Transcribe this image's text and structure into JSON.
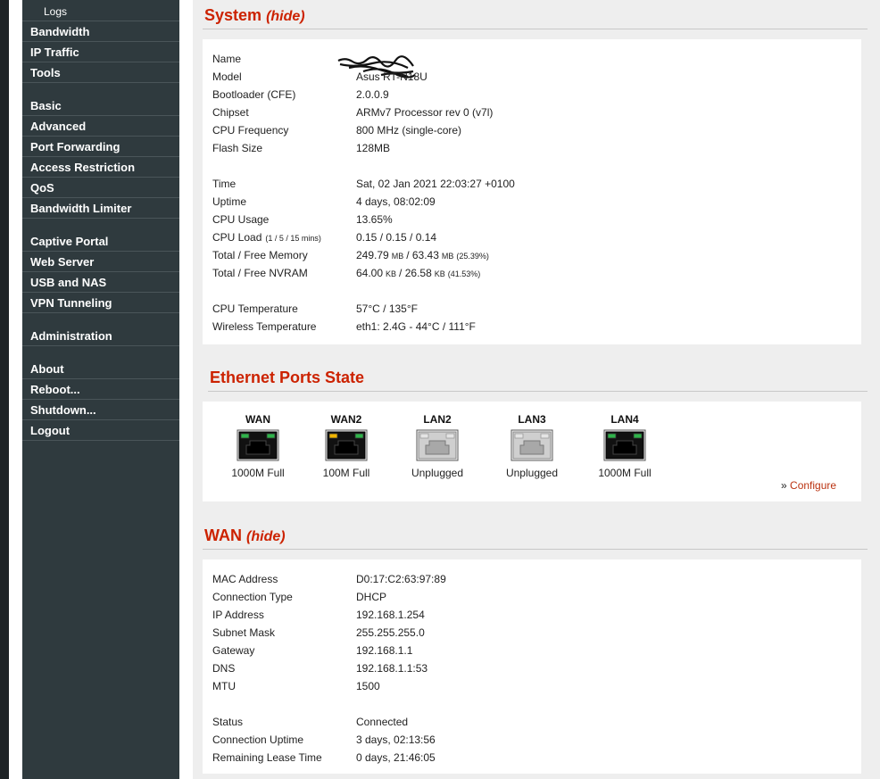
{
  "nav": {
    "items": [
      {
        "label": "Logs",
        "sub": true
      },
      {
        "label": "Bandwidth"
      },
      {
        "label": "IP Traffic"
      },
      {
        "label": "Tools"
      },
      {
        "label": "Basic"
      },
      {
        "label": "Advanced"
      },
      {
        "label": "Port Forwarding"
      },
      {
        "label": "Access Restriction"
      },
      {
        "label": "QoS"
      },
      {
        "label": "Bandwidth Limiter"
      },
      {
        "label": "Captive Portal"
      },
      {
        "label": "Web Server"
      },
      {
        "label": "USB and NAS"
      },
      {
        "label": "VPN Tunneling"
      },
      {
        "label": "Administration"
      },
      {
        "label": "About"
      },
      {
        "label": "Reboot..."
      },
      {
        "label": "Shutdown..."
      },
      {
        "label": "Logout"
      }
    ]
  },
  "system": {
    "title": "System",
    "hide_label": "(hide)",
    "rows": [
      {
        "label": "Name",
        "value": ""
      },
      {
        "label": "Model",
        "value": "Asus RT-N18U"
      },
      {
        "label": "Bootloader (CFE)",
        "value": "2.0.0.9"
      },
      {
        "label": "Chipset",
        "value": "ARMv7 Processor rev 0 (v7l)"
      },
      {
        "label": "CPU Frequency",
        "value": "800 MHz (single-core)"
      },
      {
        "label": "Flash Size",
        "value": "128MB"
      },
      {
        "label": "Time",
        "value": "Sat, 02 Jan 2021 22:03:27 +0100"
      },
      {
        "label": "Uptime",
        "value": "4 days, 08:02:09"
      },
      {
        "label": "CPU Usage",
        "value": "13.65%"
      },
      {
        "label": "CPU Load",
        "label_small": "(1 / 5 / 15 mins)",
        "value": "0.15 / 0.15 / 0.14"
      },
      {
        "label": "Total / Free Memory",
        "value_parts": [
          "249.79",
          "MB",
          "/ 63.43",
          "MB",
          "(25.39%)"
        ]
      },
      {
        "label": "Total / Free NVRAM",
        "value_parts": [
          "64.00",
          "KB",
          "/ 26.58",
          "KB",
          "(41.53%)"
        ]
      },
      {
        "label": "CPU Temperature",
        "value": "57°C / 135°F"
      },
      {
        "label": "Wireless Temperature",
        "value": "eth1: 2.4G - 44°C / 111°F"
      }
    ]
  },
  "ethernet": {
    "title": "Ethernet Ports State",
    "configure_prefix": "»",
    "configure_label": "Configure",
    "ports": [
      {
        "name": "WAN",
        "status": "1000M Full",
        "connected": true,
        "led_left": "#2fb34a",
        "led_right": "#2fb34a"
      },
      {
        "name": "WAN2",
        "status": "100M Full",
        "connected": true,
        "led_left": "#f0b400",
        "led_right": "#2fb34a"
      },
      {
        "name": "LAN2",
        "status": "Unplugged",
        "connected": false
      },
      {
        "name": "LAN3",
        "status": "Unplugged",
        "connected": false
      },
      {
        "name": "LAN4",
        "status": "1000M Full",
        "connected": true,
        "led_left": "#2fb34a",
        "led_right": "#2fb34a"
      }
    ]
  },
  "wan": {
    "title": "WAN",
    "hide_label": "(hide)",
    "rows": [
      {
        "label": "MAC Address",
        "value": "D0:17:C2:63:97:89"
      },
      {
        "label": "Connection Type",
        "value": "DHCP"
      },
      {
        "label": "IP Address",
        "value": "192.168.1.254"
      },
      {
        "label": "Subnet Mask",
        "value": "255.255.255.0"
      },
      {
        "label": "Gateway",
        "value": "192.168.1.1"
      },
      {
        "label": "DNS",
        "value": "192.168.1.1:53"
      },
      {
        "label": "MTU",
        "value": "1500"
      },
      {
        "label": "Status",
        "value": "Connected"
      },
      {
        "label": "Connection Uptime",
        "value": "3 days, 02:13:56"
      },
      {
        "label": "Remaining Lease Time",
        "value": "0 days, 21:46:05"
      }
    ]
  }
}
